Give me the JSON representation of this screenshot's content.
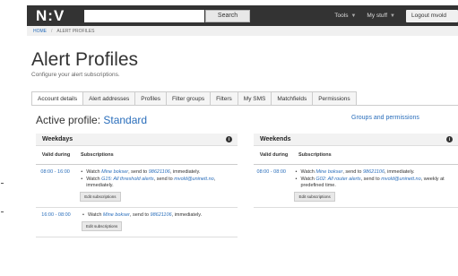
{
  "navbar": {
    "logo": "N:V",
    "search_button": "Search",
    "tools": "Tools",
    "my_stuff": "My stuff",
    "logout": "Logout mvold"
  },
  "breadcrumb": {
    "home": "HOME",
    "current": "ALERT PROFILES"
  },
  "page": {
    "title": "Alert Profiles",
    "subtitle": "Configure your alert subscriptions."
  },
  "tabs": [
    {
      "label": "Account details"
    },
    {
      "label": "Alert addresses"
    },
    {
      "label": "Profiles"
    },
    {
      "label": "Filter groups"
    },
    {
      "label": "Filters"
    },
    {
      "label": "My SMS"
    },
    {
      "label": "Matchfields"
    },
    {
      "label": "Permissions"
    }
  ],
  "profile": {
    "label": "Active profile:",
    "name": "Standard",
    "groups_link": "Groups and permissions"
  },
  "columns": {
    "valid": "Valid during",
    "subscriptions": "Subscriptions"
  },
  "weekdays": {
    "title": "Weekdays",
    "rows": [
      {
        "time": "08:00 - 16:00",
        "items": [
          {
            "pre": "Watch ",
            "filter": "Mine bokser",
            "mid": ", send to ",
            "addr": "98621106",
            "post": ", immediately."
          },
          {
            "pre": "Watch ",
            "filter": "G15: All threshold alerts",
            "mid": ", send to ",
            "addr": "mvold@uninett.no",
            "post": ", immediately."
          }
        ],
        "edit": "Edit subscriptions"
      },
      {
        "time": "16:00 - 08:00",
        "items": [
          {
            "pre": "Watch ",
            "filter": "Mine bokser",
            "mid": ", send to ",
            "addr": "98621106",
            "post": ", immediately."
          }
        ],
        "edit": "Edit subscriptions"
      }
    ]
  },
  "weekends": {
    "title": "Weekends",
    "rows": [
      {
        "time": "08:00 - 08:00",
        "items": [
          {
            "pre": "Watch ",
            "filter": "Mine bokser",
            "mid": ", send to ",
            "addr": "98621106",
            "post": ", immediately."
          },
          {
            "pre": "Watch ",
            "filter": "G02: All router alerts",
            "mid": ", send to ",
            "addr": "mvold@uninett.no",
            "post": ", weekly at predefined time."
          }
        ],
        "edit": "Edit subscriptions"
      }
    ]
  }
}
